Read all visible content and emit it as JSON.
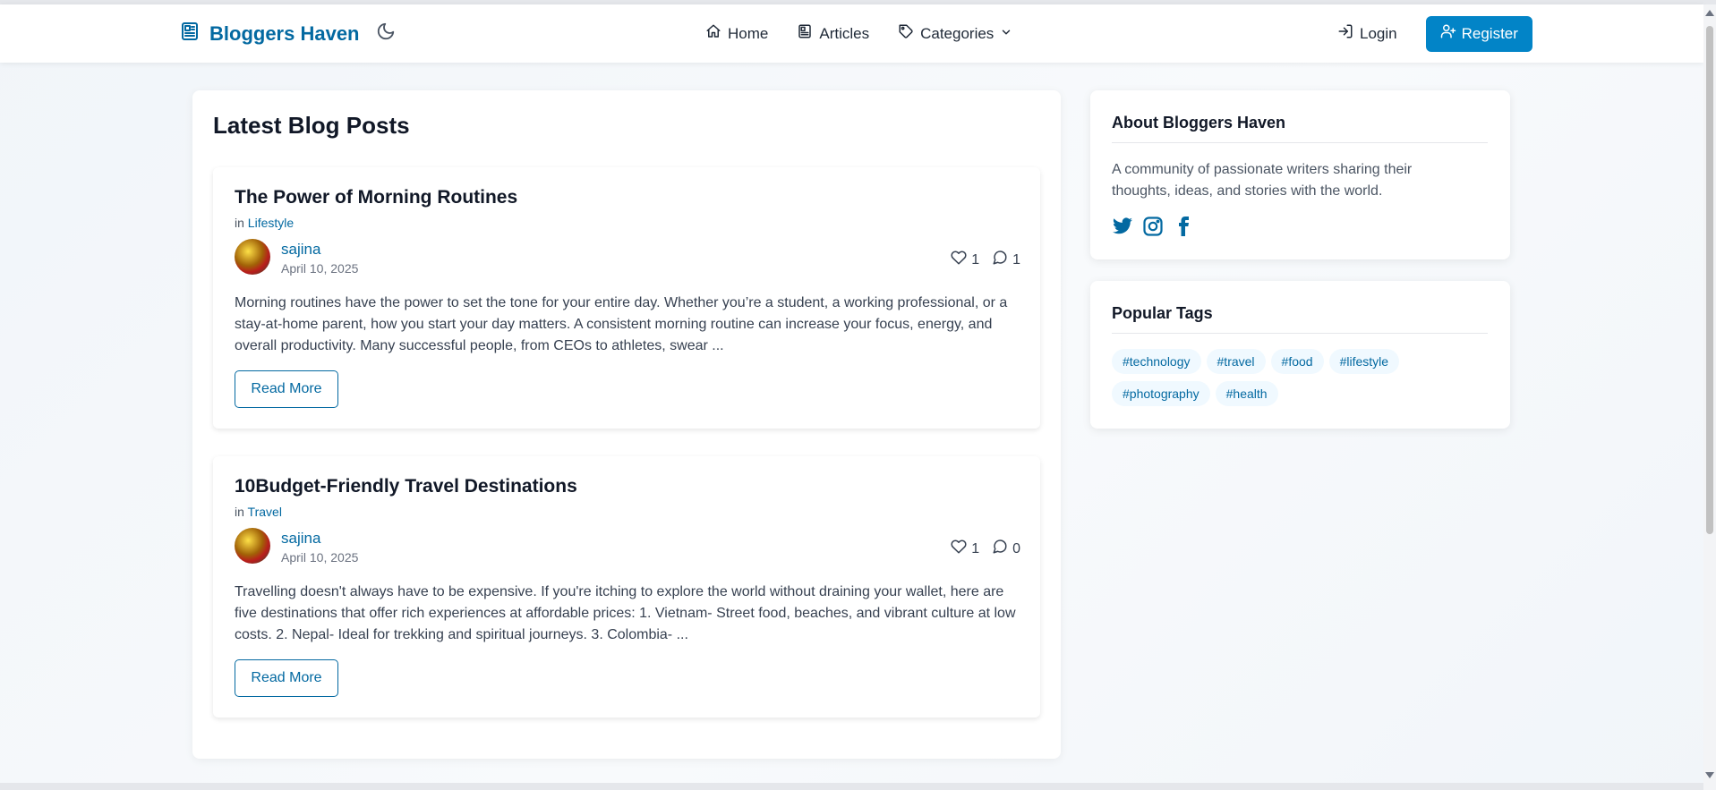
{
  "nav": {
    "brand": "Bloggers Haven",
    "links": [
      {
        "label": "Home",
        "icon": "home-icon"
      },
      {
        "label": "Articles",
        "icon": "articles-icon"
      },
      {
        "label": "Categories",
        "icon": "tag-icon"
      }
    ],
    "login": "Login",
    "register": "Register"
  },
  "main": {
    "title": "Latest Blog Posts",
    "posts": [
      {
        "title": "The Power of Morning Routines",
        "category_prefix": "in",
        "category": "Lifestyle",
        "author": "sajina",
        "date": "April 10, 2025",
        "likes": "1",
        "comments": "1",
        "excerpt": "Morning routines have the power to set the tone for your entire day. Whether you’re a student, a working professional, or a stay-at-home parent, how you start your day matters. A consistent morning routine can increase your focus, energy, and overall productivity. Many successful people, from CEOs to athletes, swear ...",
        "read_more": "Read More"
      },
      {
        "title": "10Budget-Friendly Travel Destinations",
        "category_prefix": "in",
        "category": "Travel",
        "author": "sajina",
        "date": "April 10, 2025",
        "likes": "1",
        "comments": "0",
        "excerpt": "Travelling doesn't always have to be expensive. If you're itching to explore the world without draining your wallet, here are five destinations that offer rich experiences at affordable prices: 1. Vietnam- Street food, beaches, and vibrant culture at low costs. 2. Nepal- Ideal for trekking and spiritual journeys. 3. Colombia- ...",
        "read_more": "Read More"
      }
    ]
  },
  "sidebar": {
    "about": {
      "title": "About Bloggers Haven",
      "description": "A community of passionate writers sharing their thoughts, ideas, and stories with the world.",
      "social": [
        "twitter-icon",
        "instagram-icon",
        "facebook-icon"
      ]
    },
    "tags": {
      "title": "Popular Tags",
      "items": [
        "#technology",
        "#travel",
        "#food",
        "#lifestyle",
        "#photography",
        "#health"
      ]
    }
  },
  "colors": {
    "brand": "#0369a1",
    "primary_button": "#0284c7",
    "tag_bg": "#f0f9ff"
  }
}
